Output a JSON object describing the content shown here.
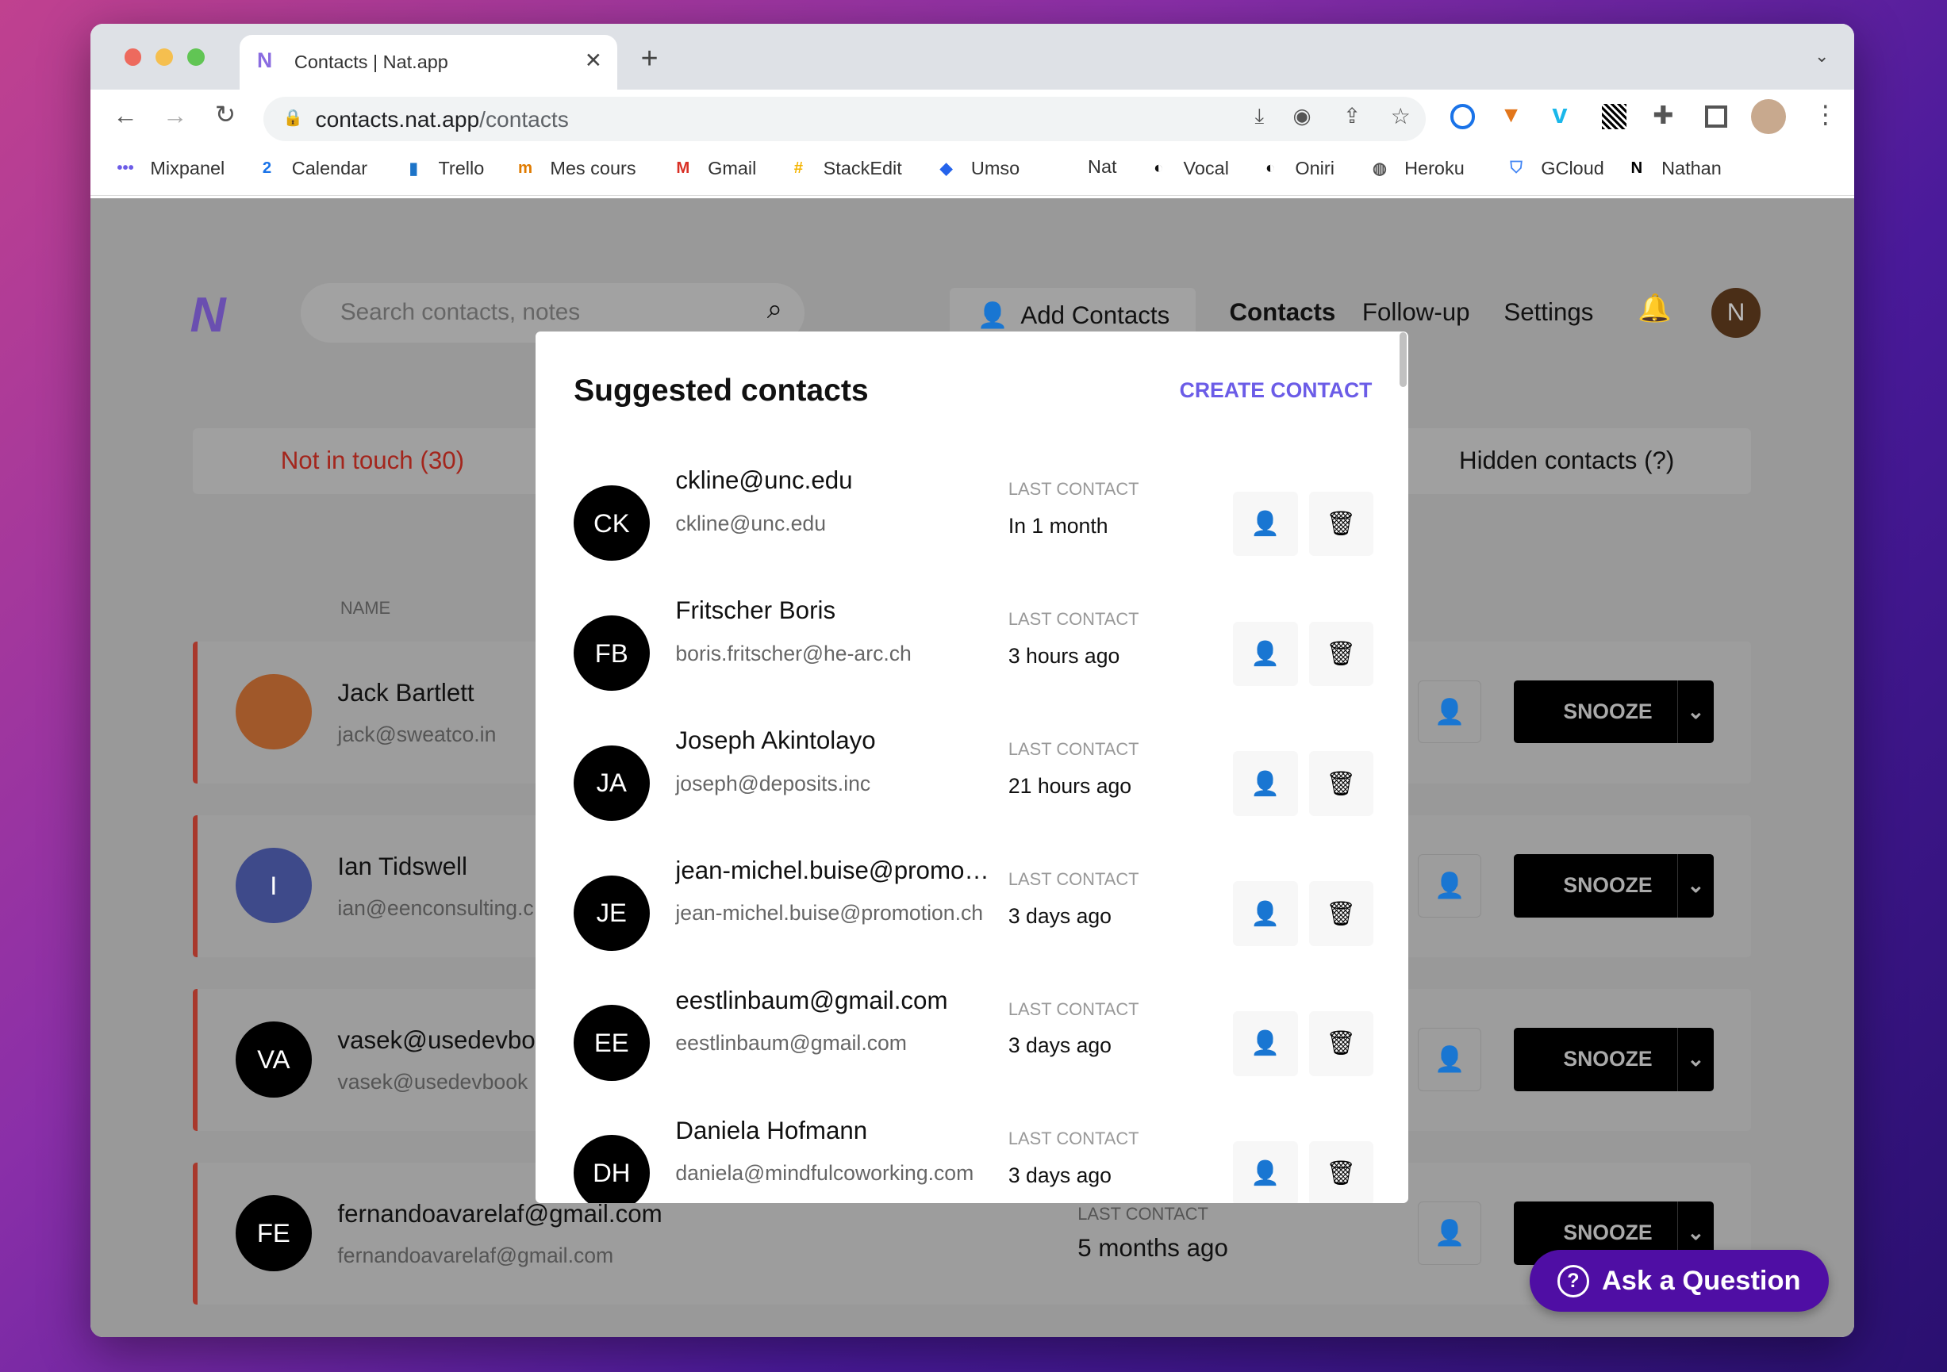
{
  "browser": {
    "tab_title": "Contacts | Nat.app",
    "url_host": "contacts.nat.app",
    "url_path": "/contacts",
    "bookmarks": [
      "Mixpanel",
      "Calendar",
      "Trello",
      "Mes cours",
      "Gmail",
      "StackEdit",
      "Umso",
      "Nat",
      "Vocal",
      "Oniri",
      "Heroku",
      "GCloud",
      "Nathan"
    ]
  },
  "header": {
    "search_placeholder": "Search contacts, notes",
    "add_contacts": "Add Contacts",
    "nav": [
      "Contacts",
      "Follow-up",
      "Settings"
    ],
    "avatar": "N"
  },
  "tabs": {
    "not_in_touch": "Not in touch (30)",
    "hidden": "Hidden contacts (?)"
  },
  "table": {
    "name_header": "NAME",
    "snooze_label": "SNOOZE",
    "last_contact_label": "LAST CONTACT",
    "rows": [
      {
        "initials": "",
        "name": "Jack Bartlett",
        "email": "jack@sweatco.in",
        "photo": true
      },
      {
        "initials": "I",
        "name": "Ian Tidswell",
        "email": "ian@eenconsulting.c",
        "color": "#3e4a8a"
      },
      {
        "initials": "VA",
        "name": "vasek@usedevbo",
        "email": "vasek@usedevbook"
      },
      {
        "initials": "FE",
        "name": "fernandoavarelaf@gmail.com",
        "email": "fernandoavarelaf@gmail.com",
        "last_contact": "5 months ago"
      }
    ]
  },
  "modal": {
    "title": "Suggested contacts",
    "create": "CREATE CONTACT",
    "last_contact_label": "LAST CONTACT",
    "rows": [
      {
        "initials": "CK",
        "name": "ckline@unc.edu",
        "email": "ckline@unc.edu",
        "last": "In 1 month"
      },
      {
        "initials": "FB",
        "name": "Fritscher Boris",
        "email": "boris.fritscher@he-arc.ch",
        "last": "3 hours ago"
      },
      {
        "initials": "JA",
        "name": "Joseph Akintolayo",
        "email": "joseph@deposits.inc",
        "last": "21 hours ago"
      },
      {
        "initials": "JE",
        "name": "jean-michel.buise@promotion.ch",
        "email": "jean-michel.buise@promotion.ch",
        "last": "3 days ago"
      },
      {
        "initials": "EE",
        "name": "eestlinbaum@gmail.com",
        "email": "eestlinbaum@gmail.com",
        "last": "3 days ago"
      },
      {
        "initials": "DH",
        "name": "Daniela Hofmann",
        "email": "daniela@mindfulcoworking.com",
        "last": "3 days ago"
      }
    ]
  },
  "help": {
    "label": "Ask a Question"
  },
  "colors": {
    "accent": "#6b5ce7",
    "alert": "#b03a30",
    "help": "#4f0ea4"
  }
}
